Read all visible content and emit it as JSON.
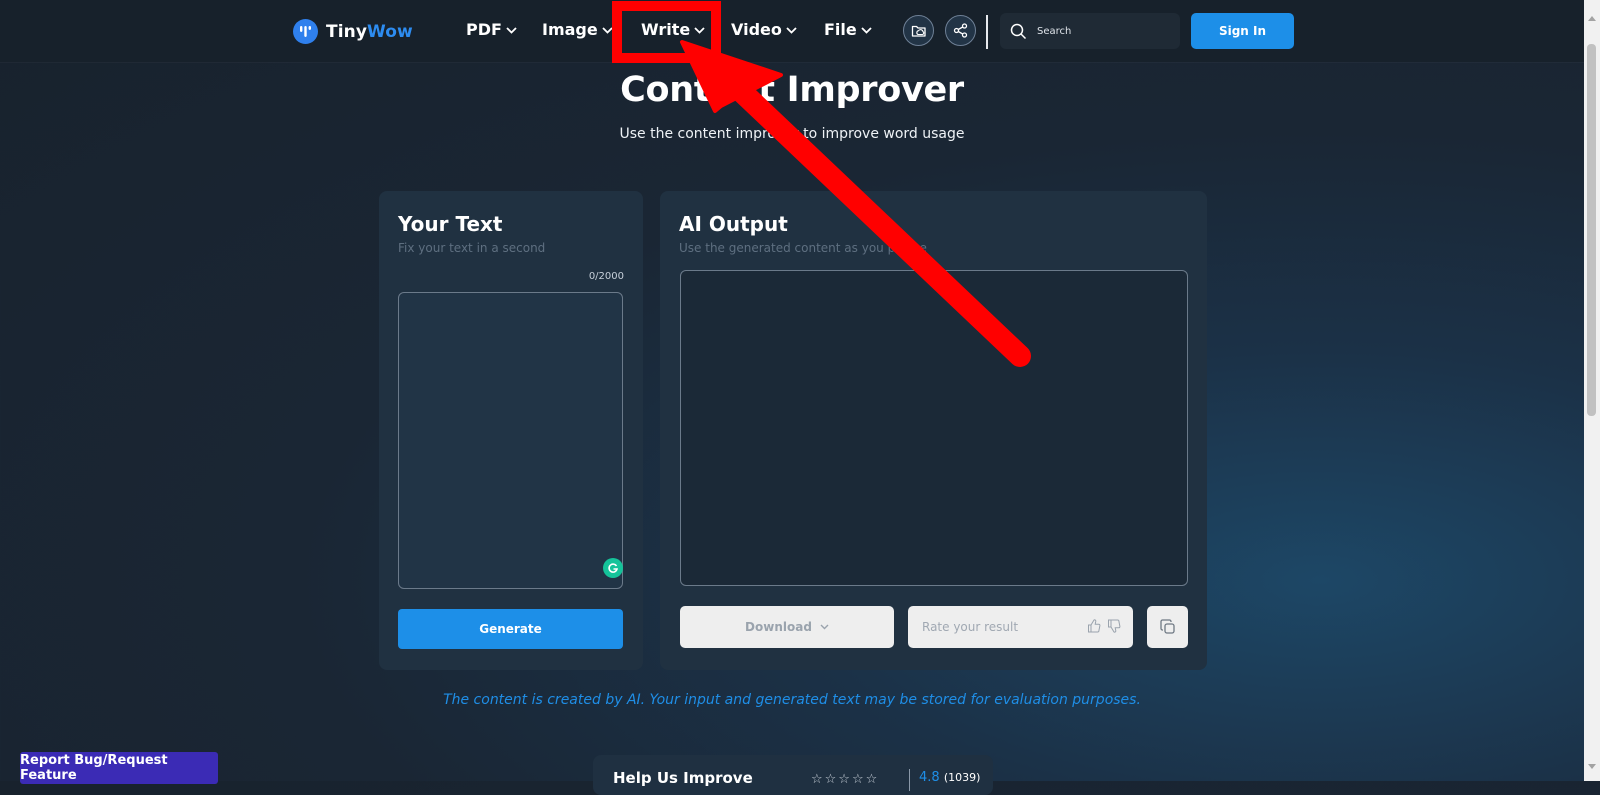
{
  "brand": {
    "part1": "Tiny",
    "part2": "Wow",
    "accent": "#2d8cf0"
  },
  "nav": {
    "items": [
      {
        "label": "PDF"
      },
      {
        "label": "Image"
      },
      {
        "label": "Write"
      },
      {
        "label": "Video"
      },
      {
        "label": "File"
      }
    ],
    "icons": [
      "cloud-folder-icon",
      "share-icon"
    ]
  },
  "search": {
    "placeholder": "Search"
  },
  "signin": {
    "label": "Sign In"
  },
  "page": {
    "title": "Content Improver",
    "subtitle": "Use the content improver to improve word usage"
  },
  "input_panel": {
    "title": "Your Text",
    "subtitle": "Fix your text in a second",
    "counter": "0/2000",
    "generate_label": "Generate"
  },
  "output_panel": {
    "title": "AI Output",
    "subtitle": "Use the generated content as you please",
    "download_label": "Download",
    "rate_placeholder": "Rate your result"
  },
  "disclaimer": "The content is created by AI. Your input and generated text may be stored for evaluation purposes.",
  "help": {
    "title": "Help Us Improve",
    "stars": "☆☆☆☆☆",
    "rating": "4.8",
    "count": "(1039)"
  },
  "report": {
    "label": "Report Bug/Request Feature"
  },
  "colors": {
    "primary": "#1d8fe8",
    "annotation": "#ff0000",
    "report": "#3b2bb5"
  }
}
